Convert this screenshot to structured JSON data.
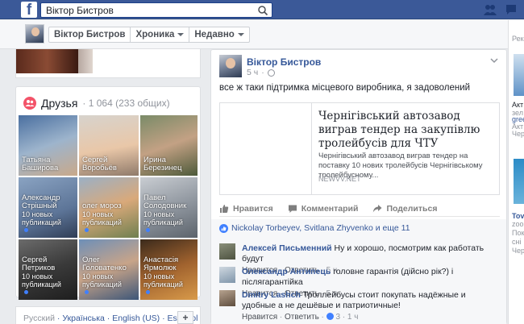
{
  "search": {
    "value": "Віктор Бистров"
  },
  "profile_bar": {
    "name_tab": "Віктор Бистров",
    "timeline_tab": "Хроника",
    "recent_tab": "Недавно"
  },
  "friends": {
    "title": "Друзья",
    "count": "· 1 064 (233 общих)",
    "items": [
      {
        "name": "Татьяна Баширова",
        "sub": ""
      },
      {
        "name": "Сергей Воробьёв",
        "sub": ""
      },
      {
        "name": "Ирина Березинец",
        "sub": ""
      },
      {
        "name": "Александр Стрішный",
        "sub": "10 новых публикаций"
      },
      {
        "name": "олег мороз",
        "sub": "10 новых публикаций"
      },
      {
        "name": "Павел Солодовник",
        "sub": "10 новых публикаций"
      },
      {
        "name": "Сергей Петриков",
        "sub": "10 новых публикаций"
      },
      {
        "name": "Олег Головатенко",
        "sub": "10 новых публикаций"
      },
      {
        "name": "Анастасія Ярмолюк",
        "sub": "10 новых публикаций"
      }
    ]
  },
  "languages": [
    "Русский",
    "Українська",
    "English (US)",
    "Español"
  ],
  "post": {
    "author": "Віктор Бистров",
    "time": "5 ч",
    "text": "все ж таки підтримка місцевого виробника, я задоволений",
    "link": {
      "title": "Чернігівський автозавод виграв тендер на закупівлю тролейбусів для ЧТУ",
      "description": "Чернігівський автозавод виграв тендер на поставку 10 нових тролейбусів Чернігівському тролейбусному...",
      "source": "NEWVV.NET"
    },
    "actions": {
      "like": "Нравится",
      "comment": "Комментарий",
      "share": "Поделиться"
    },
    "likes": "Nickolay Torbeyev, Svitlana Zhyvenko и еще 11",
    "comments": [
      {
        "name": "Алексей Письменний",
        "text": "Ну и хорошо, посмотрим как работать будут",
        "like": "Нравится",
        "reply": "Ответить",
        "reactions": "",
        "time": "5 ч"
      },
      {
        "name": "Олександр Антипець",
        "text": "головне гарантія (дійсно рік?) і післягарантійка",
        "like": "Нравится",
        "reply": "Ответить",
        "reactions": "",
        "time": "5 ч"
      },
      {
        "name": "Dmitry Lashch",
        "text": "Троллейбусы стоит покупать надёжные и удобные а не дешёвые и патриотичные!",
        "like": "Нравится",
        "reply": "Ответить",
        "reactions": "3",
        "time": "1 ч"
      }
    ]
  },
  "right_column": {
    "header": "Рек",
    "lines": [
      "Акт",
      "зел",
      "gree",
      "Акт",
      "Чер",
      "Tove",
      "zoo",
      "Пок",
      "сні",
      "Чер"
    ]
  },
  "colors": {
    "brand": "#3b5998",
    "link": "#365899",
    "friends_icon": "#f35369"
  }
}
